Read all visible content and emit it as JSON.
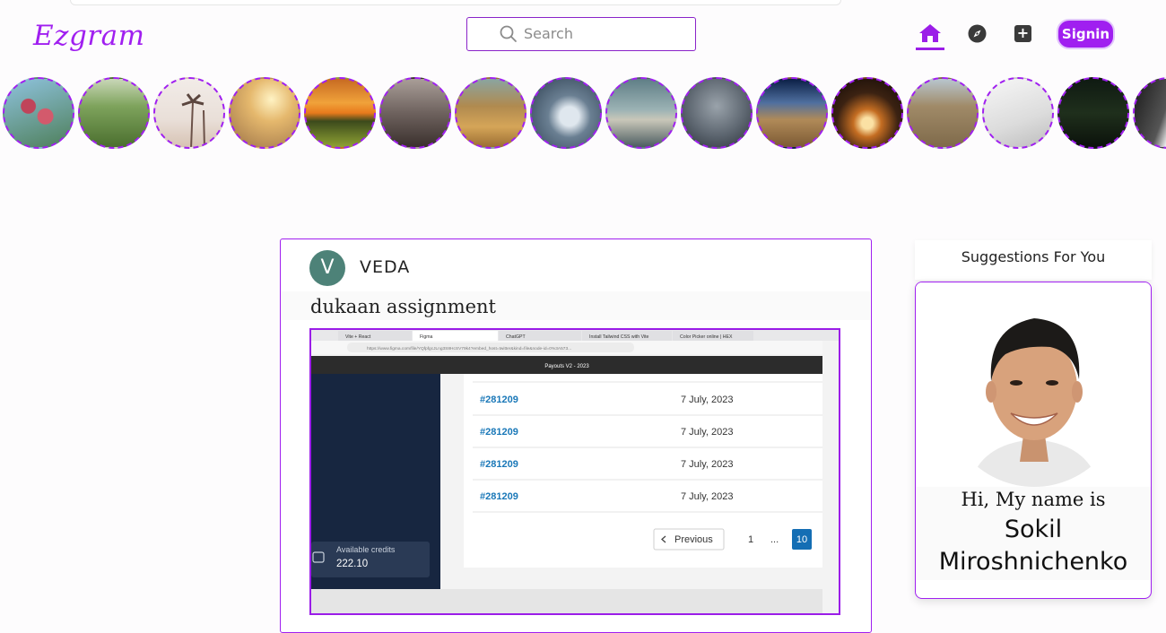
{
  "app": {
    "logo": "Ezgram"
  },
  "search": {
    "placeholder": "Search"
  },
  "nav": {
    "signin_label": "Signin"
  },
  "colors": {
    "accent": "#a01ff0",
    "avatar_bg": "#4d8278"
  },
  "stories": [
    {
      "name": "story-flowers"
    },
    {
      "name": "story-wheat-field"
    },
    {
      "name": "story-palm-trees"
    },
    {
      "name": "story-sunlit-meadow"
    },
    {
      "name": "story-sunset-field"
    },
    {
      "name": "story-vintage-car"
    },
    {
      "name": "story-golden-grass"
    },
    {
      "name": "story-coffee-cup"
    },
    {
      "name": "story-cloudy-sky"
    },
    {
      "name": "story-water-drops"
    },
    {
      "name": "story-path-trees"
    },
    {
      "name": "story-campfire-cave"
    },
    {
      "name": "story-desert-flowers"
    },
    {
      "name": "story-white-laptop"
    },
    {
      "name": "story-night-sky"
    },
    {
      "name": "story-dark-object"
    }
  ],
  "post": {
    "avatar_letter": "V",
    "username": "VEDA",
    "caption": "dukaan assignment",
    "screenshot": {
      "tabs": [
        "Vite + React",
        "Figma",
        "ChatGPT",
        "Install Tailwind CSS with Vite",
        "Color Picker online | HEX"
      ],
      "url": "https://www.figma.com/file/YQfpfgcJLng3S8HcSV79k4?embed_host=twitter&kind=file&node-id=0%3A573...",
      "page_title": "Payouts V2 - 2023",
      "rows": [
        {
          "id": "#281209",
          "date": "7 July, 2023"
        },
        {
          "id": "#281209",
          "date": "7 July, 2023"
        },
        {
          "id": "#281209",
          "date": "7 July, 2023"
        },
        {
          "id": "#281209",
          "date": "7 July, 2023"
        }
      ],
      "pagination": {
        "prev": "Previous",
        "page1": "1",
        "ellipsis": "...",
        "current": "10"
      },
      "credits_label": "Available credits",
      "credits_value": "222.10"
    }
  },
  "suggestions": {
    "title": "Suggestions For You",
    "greeting": "Hi, My name is",
    "name": "Sokil Miroshnichenko"
  }
}
